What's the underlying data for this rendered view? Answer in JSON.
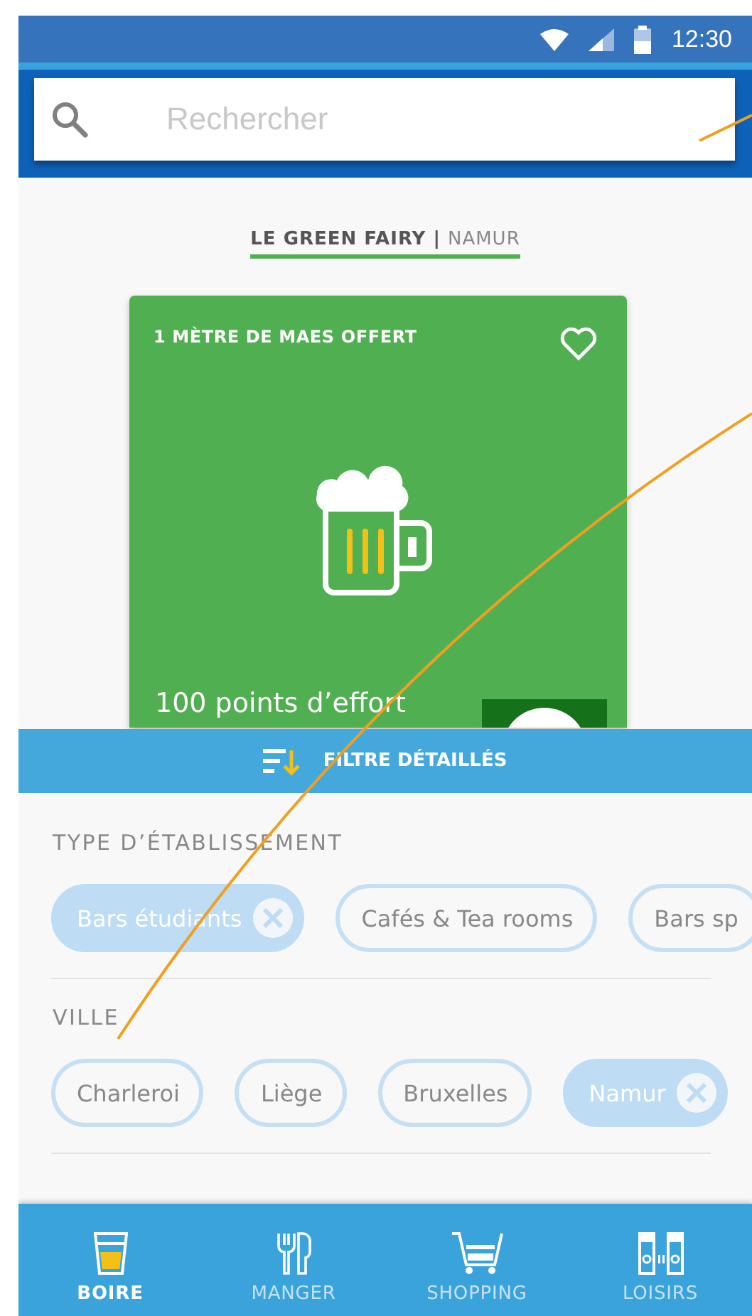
{
  "status_bar": {
    "time": "12:30"
  },
  "search": {
    "placeholder": "Rechercher"
  },
  "venue": {
    "name": "LE GREEN FAIRY",
    "separator": "|",
    "city": "NAMUR"
  },
  "offer_card": {
    "title": "1 MÈTRE DE MAES OFFERT",
    "favorite": false,
    "points": "100 points d’effort"
  },
  "filter": {
    "title": "FILTRE DÉTAILLÉS",
    "sections": [
      {
        "heading": "TYPE D’ÉTABLISSEMENT",
        "chips": [
          {
            "label": "Bars étudiants",
            "selected": true
          },
          {
            "label": "Cafés & Tea rooms",
            "selected": false
          },
          {
            "label": "Bars sp",
            "selected": false
          }
        ]
      },
      {
        "heading": "VILLE",
        "chips": [
          {
            "label": "Charleroi",
            "selected": false
          },
          {
            "label": "Liège",
            "selected": false
          },
          {
            "label": "Bruxelles",
            "selected": false
          },
          {
            "label": "Namur",
            "selected": true
          }
        ]
      }
    ]
  },
  "bottom_nav": [
    {
      "kind": "drink",
      "label": "BOIRE",
      "selected": true
    },
    {
      "kind": "food",
      "label": "MANGER",
      "selected": false
    },
    {
      "kind": "cart",
      "label": "SHOPPING",
      "selected": false
    },
    {
      "kind": "leisure",
      "label": "LOISIRS",
      "selected": false
    }
  ]
}
